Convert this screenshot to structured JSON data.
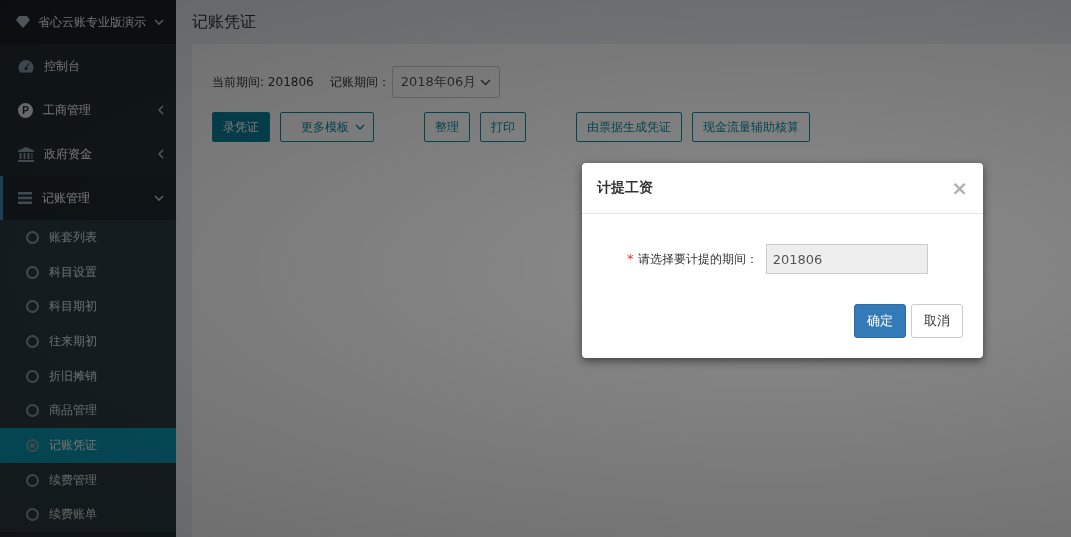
{
  "sidebar": {
    "brand": "省心云账专业版演示",
    "items": [
      {
        "kind": "link",
        "label": "控制台"
      },
      {
        "kind": "group",
        "label": "工商管理",
        "icon_text": "P",
        "expanded": false
      },
      {
        "kind": "group",
        "label": "政府资金",
        "expanded": false
      },
      {
        "kind": "group",
        "label": "记账管理",
        "expanded": true,
        "children": [
          {
            "label": "账套列表",
            "selected": false
          },
          {
            "label": "科目设置",
            "selected": false
          },
          {
            "label": "科目期初",
            "selected": false
          },
          {
            "label": "往来期初",
            "selected": false
          },
          {
            "label": "折旧摊销",
            "selected": false
          },
          {
            "label": "商品管理",
            "selected": false
          },
          {
            "label": "记账凭证",
            "selected": true
          },
          {
            "label": "续费管理",
            "selected": false
          },
          {
            "label": "续费账单",
            "selected": false
          }
        ]
      }
    ]
  },
  "page": {
    "title": "记账凭证",
    "current_period_label": "当前期间: 201806",
    "period_label": "记账期间：",
    "period_select": "2018年06月",
    "toolbar": [
      {
        "label": "录凭证",
        "kind": "primary"
      },
      {
        "label": "更多模板",
        "kind": "dropdown"
      },
      {
        "label": "整理",
        "kind": "outline"
      },
      {
        "label": "打印",
        "kind": "outline"
      },
      {
        "label": "由票据生成凭证",
        "kind": "outline"
      },
      {
        "label": "现金流量辅助核算",
        "kind": "outline"
      }
    ]
  },
  "dialog": {
    "title": "计提工资",
    "close": "×",
    "field": {
      "label": "请选择要计提的期间：",
      "required_mark": "*",
      "value": "201806",
      "disabled": true
    },
    "buttons": [
      {
        "label": "确定",
        "kind": "primary"
      },
      {
        "label": "取消",
        "kind": "default"
      }
    ]
  }
}
